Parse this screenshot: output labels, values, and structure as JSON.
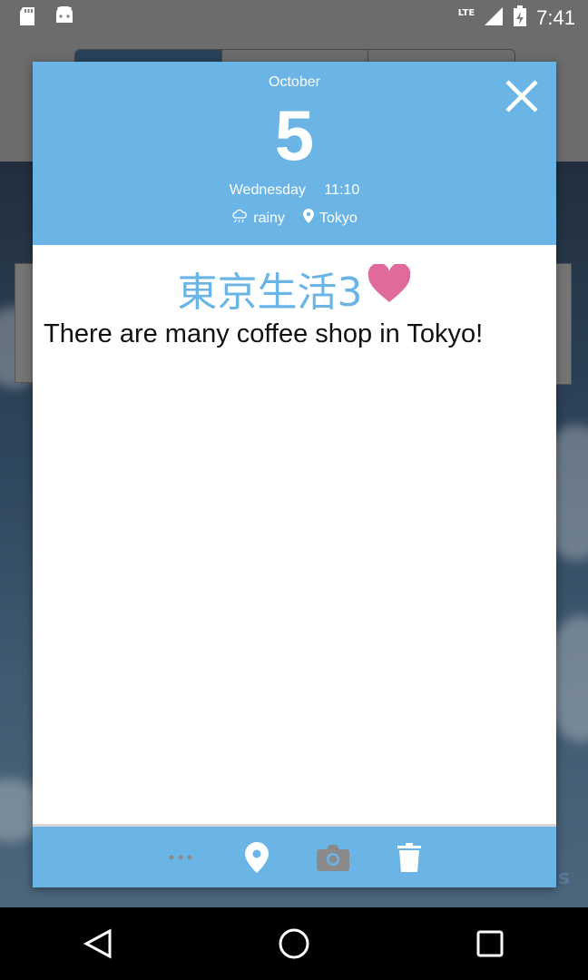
{
  "status_bar": {
    "network": "LTE",
    "time": "7:41",
    "icons": [
      "sd-card-icon",
      "android-icon",
      "signal-icon",
      "battery-icon"
    ]
  },
  "background": {
    "bottom_text": "s"
  },
  "dialog": {
    "month": "October",
    "day": "5",
    "weekday": "Wednesday",
    "time": "11:10",
    "weather": "rainy",
    "location": "Tokyo",
    "title": "東京生活3",
    "title_emoji": "❤",
    "body": "There are many coffee shop in Tokyo!"
  },
  "footer_actions": [
    "more-icon",
    "location-icon",
    "camera-icon",
    "trash-icon"
  ],
  "colors": {
    "header_blue": "#6ab4e6",
    "heart_pink": "#e06a9c",
    "text_dark": "#111111"
  }
}
